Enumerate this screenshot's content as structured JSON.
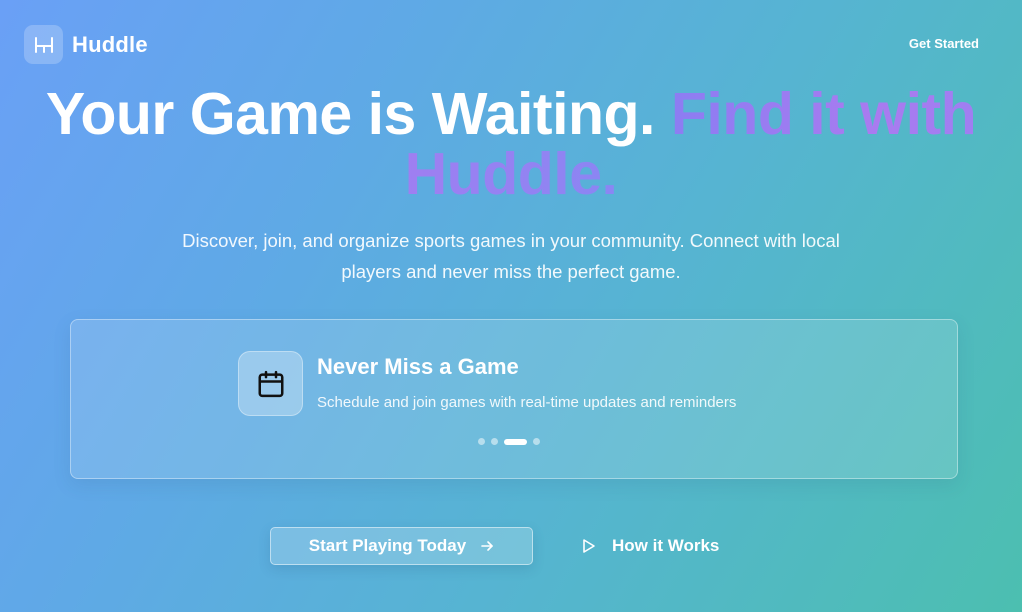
{
  "header": {
    "brand": "Huddle",
    "logo_icon": "goalpost-icon",
    "get_started": "Get Started"
  },
  "hero": {
    "title_main": "Your Game is Waiting.",
    "title_accent": "Find it with Huddle.",
    "subtitle": "Discover, join, and organize sports games in your community. Connect with local players and never miss the perfect game."
  },
  "feature": {
    "icon": "calendar-icon",
    "title": "Never Miss a Game",
    "description": "Schedule and join games with real-time updates and reminders",
    "slide_count": 4,
    "active_slide": 3
  },
  "cta": {
    "primary_label": "Start Playing Today",
    "primary_icon": "arrow-right-icon",
    "secondary_label": "How it Works",
    "secondary_icon": "play-icon"
  },
  "colors": {
    "accent_gradient_start": "#8c7df2",
    "accent_gradient_end": "#a97bf0",
    "background_start": "#6aa0f6",
    "background_end": "#4cbfb0"
  }
}
